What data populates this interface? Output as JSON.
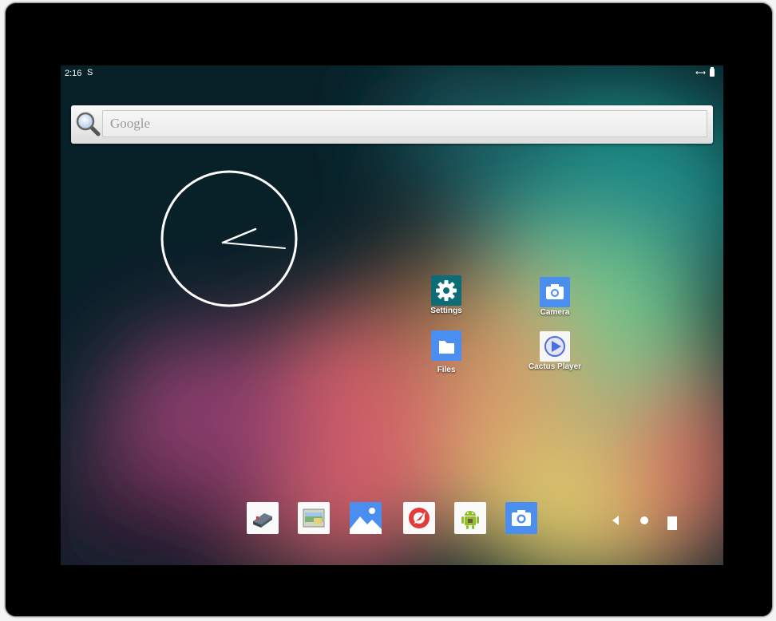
{
  "status_bar": {
    "time": "2:16",
    "notification_glyph": "S"
  },
  "search": {
    "placeholder": "Google"
  },
  "apps": [
    {
      "label": "Settings",
      "icon": "gear-icon"
    },
    {
      "label": "Camera",
      "icon": "camera-icon"
    },
    {
      "label": "Files",
      "icon": "folder-icon"
    },
    {
      "label": "Cactus Player",
      "icon": "play-icon"
    }
  ],
  "dock": [
    "network-icon",
    "gallery-app-icon",
    "photos-icon",
    "browser-icon",
    "android-icon",
    "camera-icon"
  ],
  "nav": [
    "back-icon",
    "home-icon",
    "recents-icon"
  ],
  "colors": {
    "settings_tile": "#0e6b78",
    "blue_tile": "#4a8ff0",
    "wallpaper_dark": "#082028"
  }
}
